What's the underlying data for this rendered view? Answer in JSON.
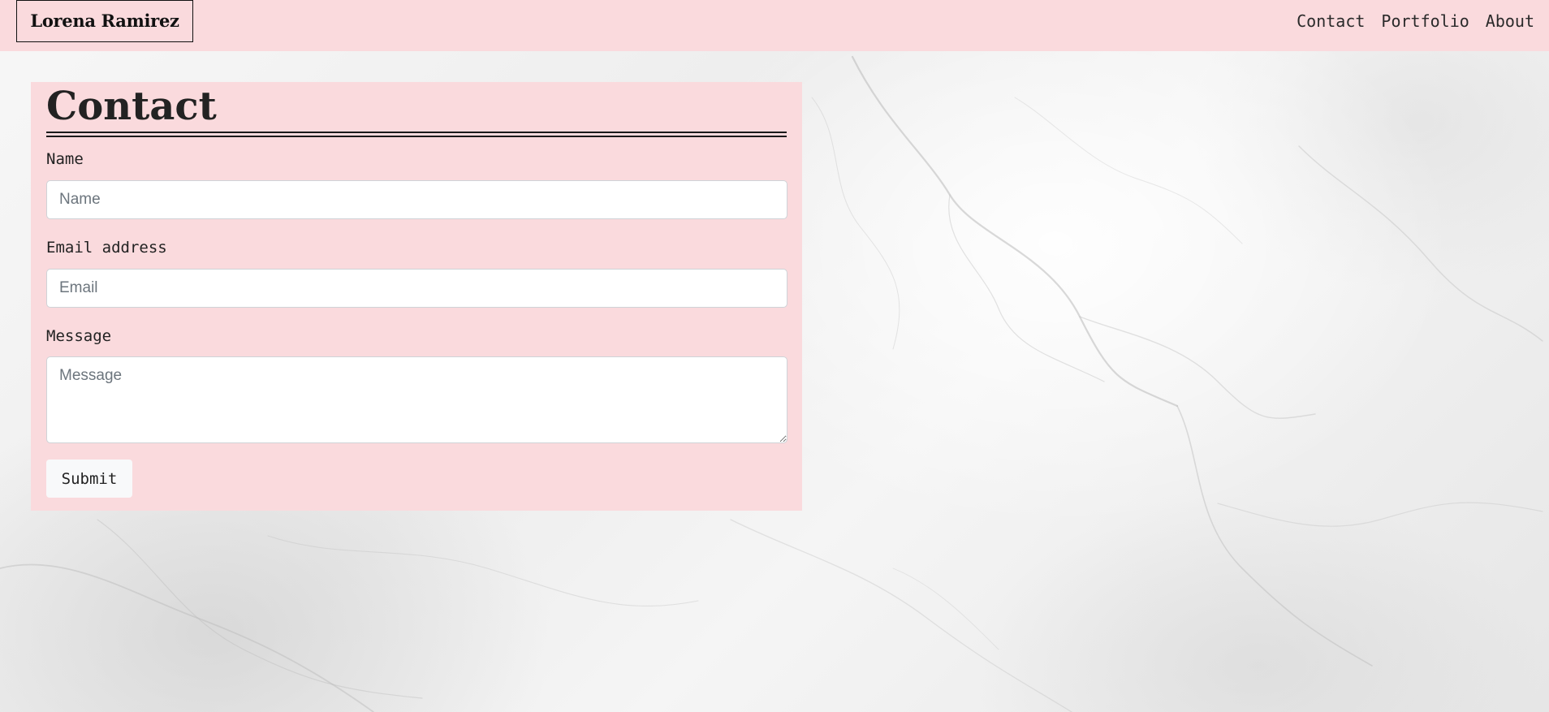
{
  "navbar": {
    "brand": "Lorena Ramirez",
    "links": [
      "Contact",
      "Portfolio",
      "About"
    ]
  },
  "contact": {
    "title": "Contact",
    "fields": {
      "name": {
        "label": "Name",
        "placeholder": "Name",
        "value": ""
      },
      "email": {
        "label": "Email address",
        "placeholder": "Email",
        "value": ""
      },
      "message": {
        "label": "Message",
        "placeholder": "Message",
        "value": ""
      }
    },
    "submit_label": "Submit"
  },
  "colors": {
    "accent_pink": "#fadadd",
    "text_dark": "#222222",
    "background": "white marble texture"
  }
}
